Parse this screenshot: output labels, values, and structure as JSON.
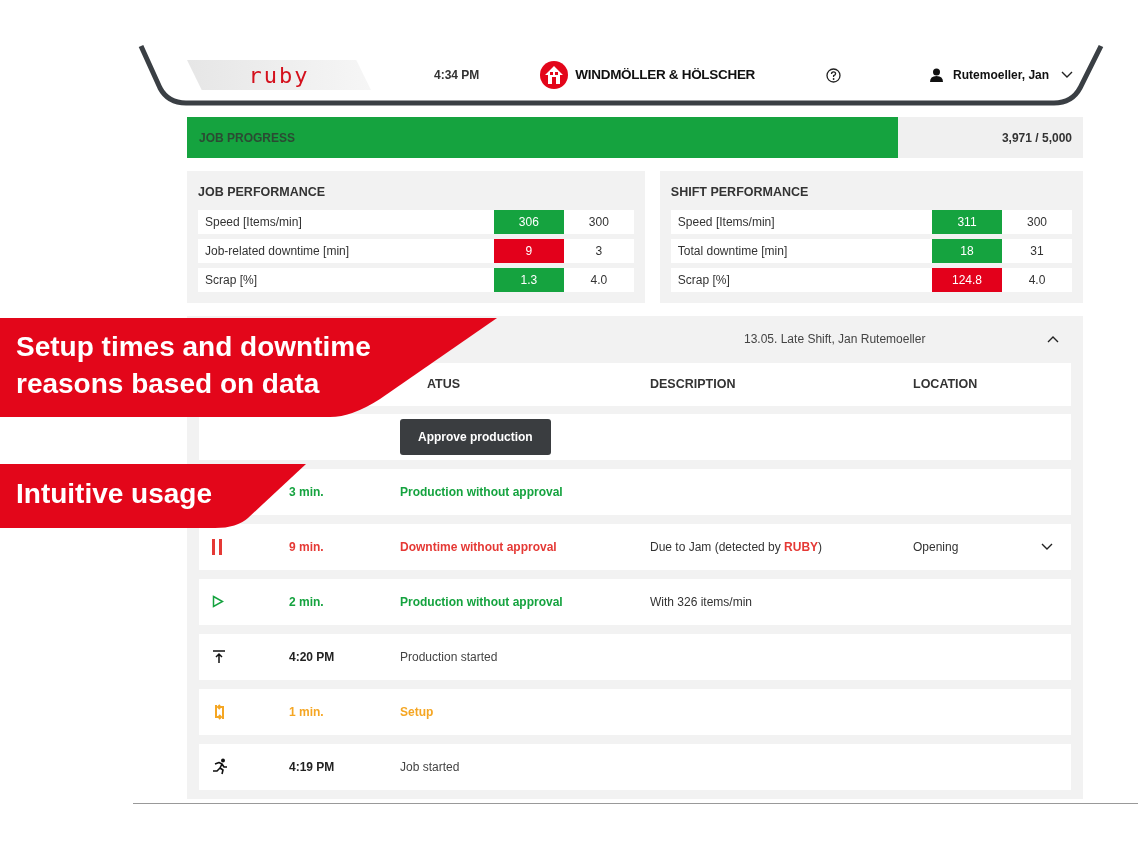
{
  "header": {
    "logo": "ruby",
    "time": "4:34 PM",
    "brand": "WINDMÖLLER & HÖLSCHER",
    "user": "Rutemoeller, Jan"
  },
  "progress": {
    "label": "JOB PROGRESS",
    "reading": "3,971 / 5,000",
    "level": 0.794
  },
  "performance": [
    {
      "title": "JOB PERFORMANCE",
      "rows": [
        {
          "label": "Speed [Items/min]",
          "value": "306",
          "target": "300",
          "color": "#15a33f"
        },
        {
          "label": "Job-related downtime [min]",
          "value": "9",
          "target": "3",
          "color": "#e3001b"
        },
        {
          "label": "Scrap [%]",
          "value": "1.3",
          "target": "4.0",
          "color": "#15a33f"
        }
      ]
    },
    {
      "title": "SHIFT PERFORMANCE",
      "rows": [
        {
          "label": "Speed [Items/min]",
          "value": "311",
          "target": "300",
          "color": "#15a33f"
        },
        {
          "label": "Total downtime [min]",
          "value": "18",
          "target": "31",
          "color": "#15a33f"
        },
        {
          "label": "Scrap [%]",
          "value": "124.8",
          "target": "4.0",
          "color": "#e3001b"
        }
      ]
    }
  ],
  "shift_log": {
    "shift": "13.05. Late Shift, Jan Rutemoeller",
    "expanded": true,
    "columns": [
      "ATUS",
      "DESCRIPTION",
      "LOCATION"
    ],
    "rows": [
      {
        "kind": "action",
        "button": "Approve production"
      },
      {
        "kind": "production",
        "icon_covered": true,
        "time": "3 min.",
        "status": "Production without approval"
      },
      {
        "kind": "downtime",
        "time": "9 min.",
        "status": "Downtime without approval",
        "description": "Due to Jam (detected by **RUBY**)",
        "location": "Opening",
        "expandable": true
      },
      {
        "kind": "production",
        "time": "2 min.",
        "status": "Production without approval",
        "description": "With 326 items/min"
      },
      {
        "kind": "production_start",
        "time": "4:20 PM",
        "status": "Production started"
      },
      {
        "kind": "setup",
        "time": "1 min.",
        "status": "Setup"
      },
      {
        "kind": "job_start",
        "time": "4:19 PM",
        "status": "Job started"
      }
    ]
  },
  "callouts": [
    {
      "text": "Setup times and downtime reasons based on data"
    },
    {
      "text": "Intuitive usage"
    }
  ]
}
